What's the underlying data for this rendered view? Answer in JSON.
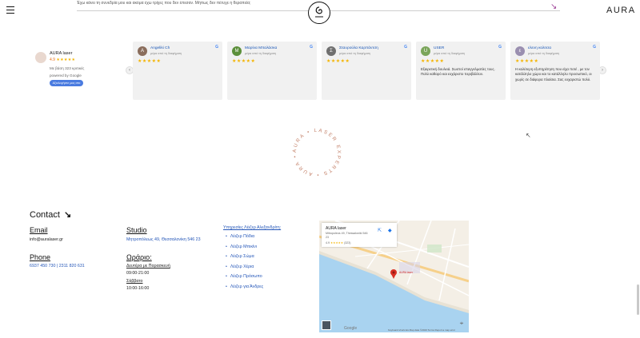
{
  "header": {
    "marquee_text": "Έχω κάνει τη συνεδρία μου και ακόμα έχω τρίχες που δεν έπεσαν. Μήπως δεν πέτυχε η θεραπεία;",
    "brand": "AURA"
  },
  "google_summary": {
    "name": "AURA laser",
    "score": "4.9",
    "stars": "★★★★★",
    "based_on": "Με βάση 323 κριτικές",
    "powered_by": "powered by Google",
    "review_button": "Αξιολογήστε μας στο"
  },
  "reviews": [
    {
      "name": "Angeliki Ch",
      "date": "μέρα από τη διαφήμιση",
      "initial": "A",
      "avatar_color": "#8a6d5c",
      "stars": "★★★★★",
      "text": ""
    },
    {
      "name": "Μαρίνα Μπαλάσκα",
      "date": "μέρα από τη διαφήμιση",
      "initial": "M",
      "avatar_color": "#5b8f3a",
      "stars": "★★★★★",
      "text": ""
    },
    {
      "name": "Σταυρούλα Καρπάντση",
      "date": "μέρα από τη διαφήμιση",
      "initial": "Σ",
      "avatar_color": "#6f6f6f",
      "stars": "★★★★★",
      "text": ""
    },
    {
      "name": "USER",
      "date": "μέρα από τη διαφήμιση",
      "initial": "U",
      "avatar_color": "#7aa55a",
      "stars": "★★★★★",
      "text": "Εξαιρετική δουλειά. Σωστοί επαγγελματίες τους. Πολύ καθαρό και ευχάριστο περιβάλλον."
    },
    {
      "name": "ελενη κολιτσα",
      "date": "μέρα από τη διαφήμιση",
      "initial": "ε",
      "avatar_color": "#9a8fb0",
      "stars": "★★★★★",
      "text": "Η καλύτερη εξυπηρέτηση που είχα ποτέ , με τον κατάλληλο χώρο και το κατάλληλο προσωπικό, οι χωρίς σε διάφορα πλαίσια. Σας ευχαριστώ πολύ."
    }
  ],
  "badge": {
    "ring_text": "AURA • LASER EXPERTS • AURA • LASER EXPERTS •"
  },
  "contact": {
    "title": "Contact",
    "arrow": "↘",
    "email_label": "Email",
    "email_value": "info@auralaser.gr",
    "phone_label": "Phone",
    "phone_value": "6937 450 730 | 2311 820 631",
    "studio_label": "Studio",
    "studio_address": "Μητροπόλεως 49, Θεσσαλονίκη 546 23",
    "hours_label": "Ωράριο:",
    "weekdays_label": "Δευτέρα με Παρασκευή",
    "weekdays_hours": "09:00-21:00",
    "saturday_label": "Σάββατο",
    "saturday_hours": "10:00-16:00"
  },
  "services": {
    "title": "Υπηρεσίες Λέιζερ Αλεξανδρίτη:",
    "items": [
      "Λέιζερ Πόδια",
      "Λέιζερ Μπικίνι",
      "Λέιζερ Σώμα",
      "Λέιζερ Χέρια",
      "Λέιζερ Πρόσωπο",
      "Λέιζερ για Άνδρες"
    ]
  },
  "map": {
    "place_name": "AURA laser",
    "address": "Mitropoleos 49, Thessaloniki 546 23",
    "rating": "4.9",
    "stars": "★★★★★",
    "reviews_count": "(323)",
    "footer": "Keyboard shortcuts   Map data ©2023   Terms   Report a map error",
    "google": "Google"
  }
}
